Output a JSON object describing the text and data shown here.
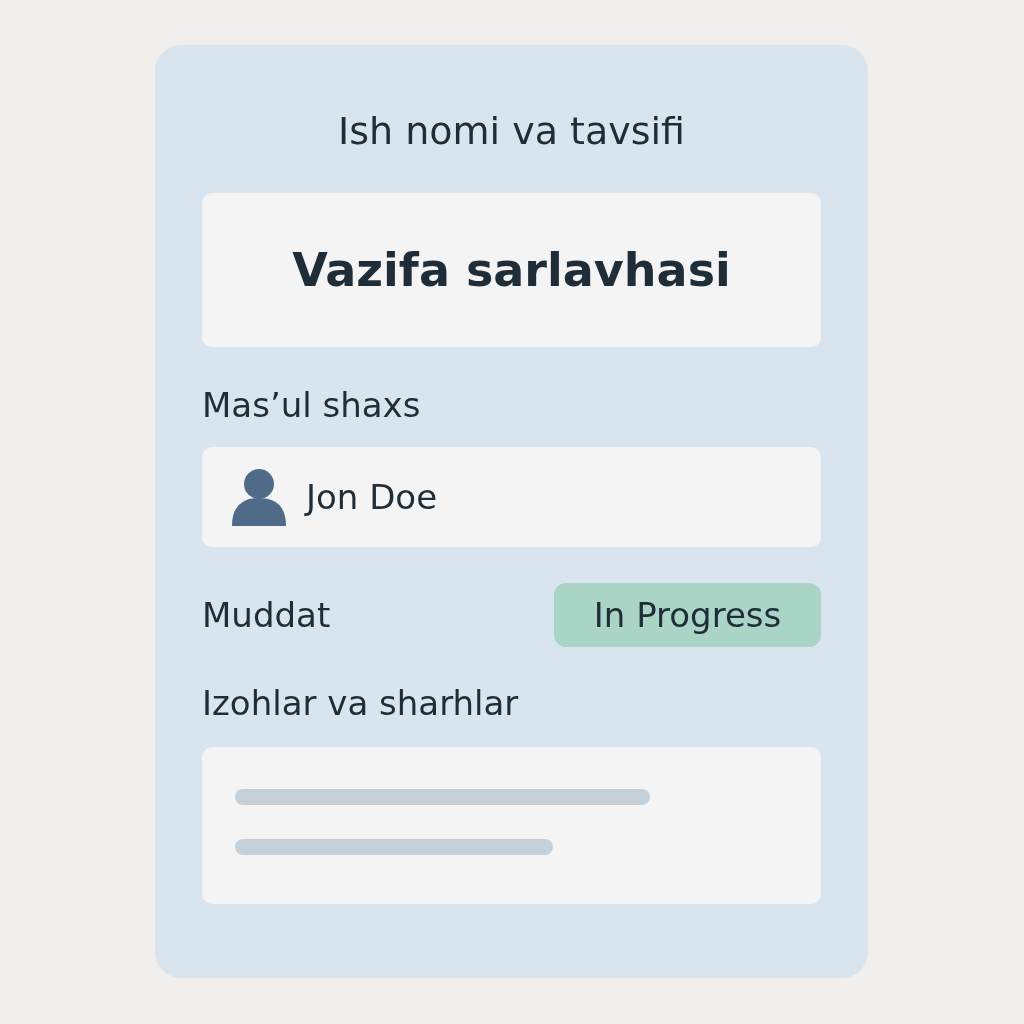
{
  "heading": "Ish nomi va tavsifi",
  "title_field": {
    "value": "Vazifa sarlavhasi"
  },
  "assignee": {
    "label": "Mas’ul shaxs",
    "value": "Jon Doe"
  },
  "deadline": {
    "label": "Muddat",
    "status": "In Progress",
    "color": "#a9d4c6"
  },
  "comments": {
    "label": "Izohlar va sharhlar"
  }
}
